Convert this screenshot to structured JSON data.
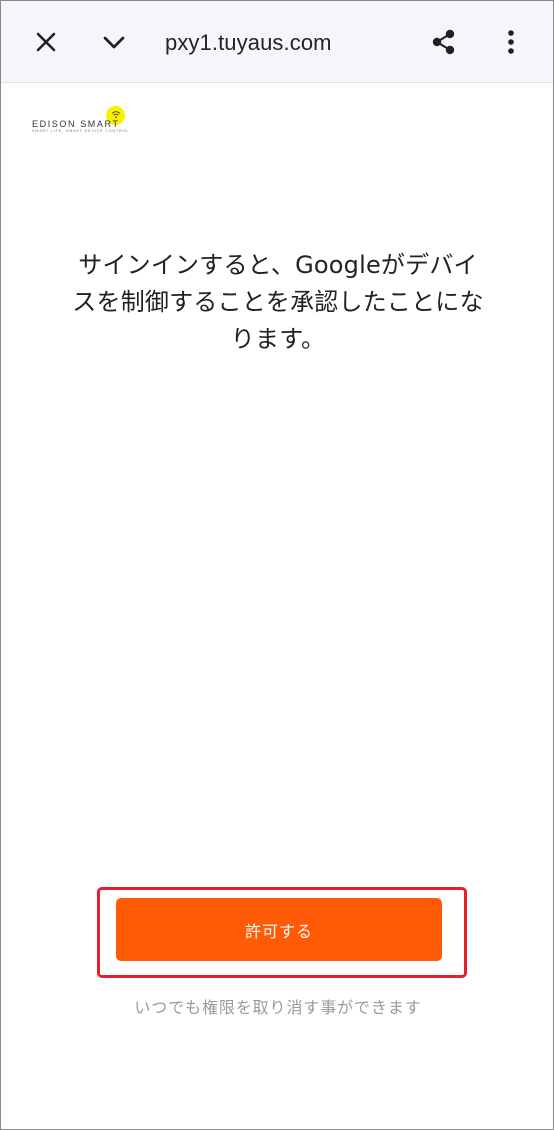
{
  "browser": {
    "url": "pxy1.tuyaus.com",
    "icons": {
      "close": "close-icon",
      "collapse": "chevron-down-icon",
      "share": "share-icon",
      "menu": "more-vertical-icon"
    }
  },
  "brand": {
    "name": "EDISON SMART",
    "tagline": "SMART LIFE, SMART DEVICE CONTROL",
    "icon": "wifi-icon",
    "accent_color": "#f7f000"
  },
  "content": {
    "message": "サインインすると、Googleがデバイスを制御することを承認したことになります。",
    "allow_button": "許可する",
    "revoke_note": "いつでも権限を取り消す事ができます"
  },
  "colors": {
    "button": "#ff5a05",
    "highlight": "#e51f2b"
  }
}
